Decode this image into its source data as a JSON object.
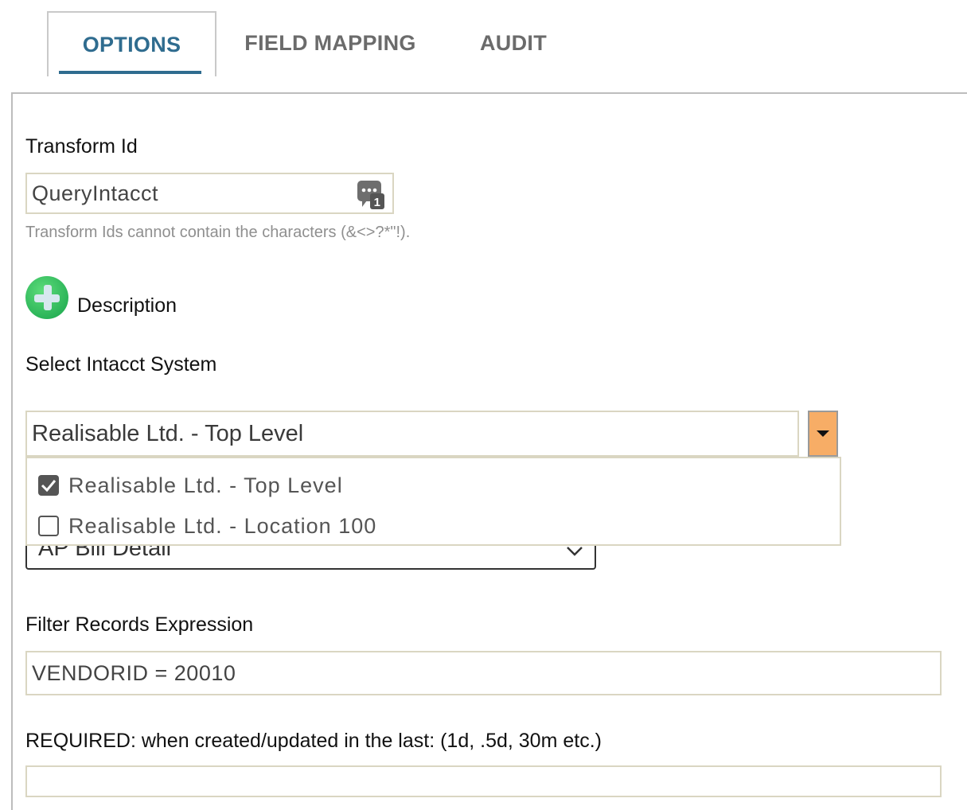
{
  "tabs": [
    {
      "label": "OPTIONS",
      "active": true
    },
    {
      "label": "FIELD MAPPING",
      "active": false
    },
    {
      "label": "AUDIT",
      "active": false
    }
  ],
  "transform": {
    "label": "Transform Id",
    "value": "QueryIntacct",
    "hint": "Transform Ids cannot contain the characters (&<>?*\"!)."
  },
  "description": {
    "label": "Description"
  },
  "intacct_system": {
    "label": "Select Intacct System",
    "selected": "Realisable Ltd. - Top Level",
    "options": [
      {
        "label": "Realisable Ltd. - Top Level",
        "checked": true
      },
      {
        "label": "Realisable Ltd. - Location 100",
        "checked": false
      }
    ]
  },
  "object_select": {
    "value": "AP Bill Detail"
  },
  "filter": {
    "label": "Filter Records Expression",
    "value": "VENDORID = 20010"
  },
  "required": {
    "label": "REQUIRED: when created/updated in the last: (1d, .5d, 30m etc.)"
  },
  "colors": {
    "accent": "#2f6c8f",
    "dropdown_button": "#f7ad66",
    "add_icon": "#22c55e"
  }
}
